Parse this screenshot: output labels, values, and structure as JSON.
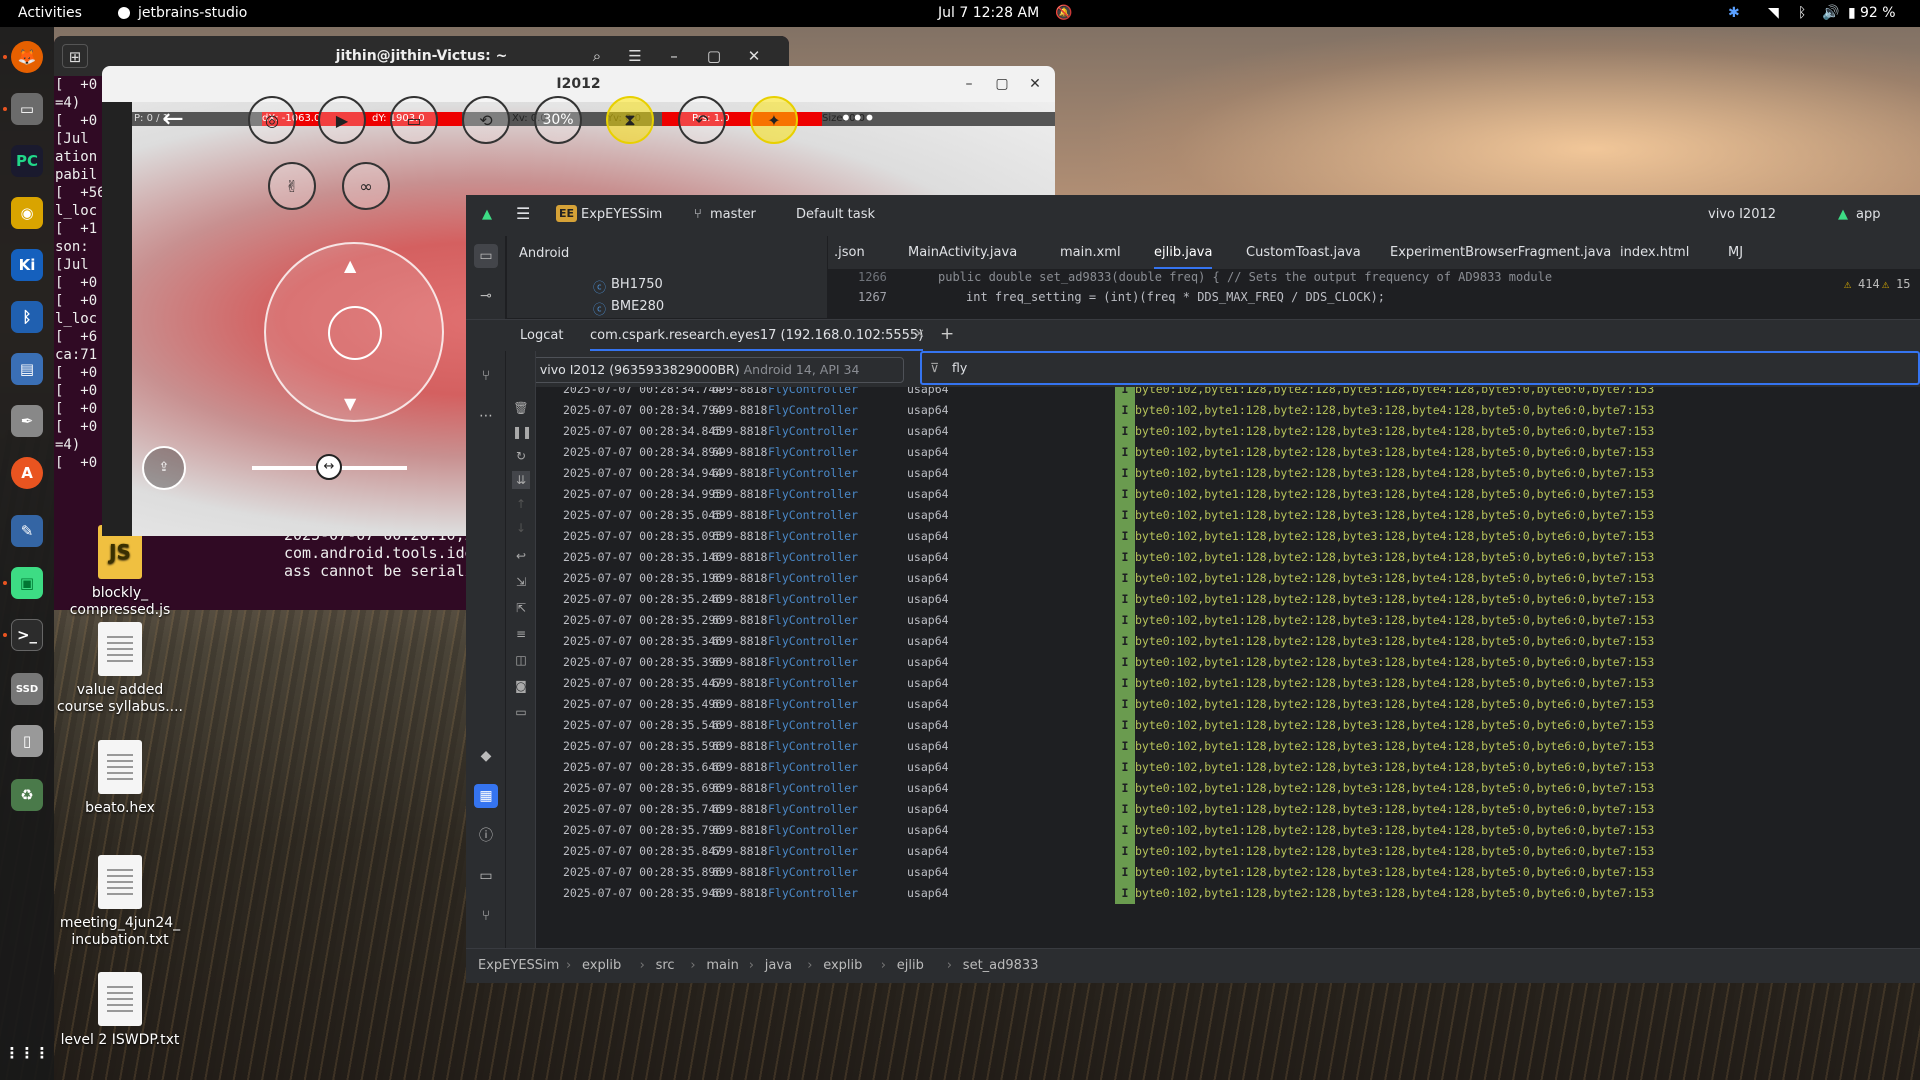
{
  "topbar": {
    "activities": "Activities",
    "app_name": "jetbrains-studio",
    "datetime": "Jul 7  12:28 AM",
    "battery": "92 %"
  },
  "terminal": {
    "title": "jithin@jithin-Victus: ~",
    "lines": [
      "[  +0",
      "=4)",
      "[  +0",
      "[Jul",
      "ation",
      "pabil",
      "[  +56",
      "l_loc",
      "[  +1",
      "son:",
      "[Jul",
      "[  +0",
      "[  +0",
      "l_loc",
      "[  +6",
      "ca:71",
      "[  +0",
      "[  +0",
      "[  +0",
      "[  +0",
      "=4)",
      "[  +0"
    ],
    "bottom_lines": "2025-07-07 00:26:10,265 [4\ncom.android.tools.idea.log\nass cannot be serialized p"
  },
  "mirror": {
    "title": "I2012",
    "tracks": {
      "p": "P: 0 / 1",
      "dx": "dX: -1063.0",
      "dy": "dY: 1903.0",
      "xv": "Xv: 0.0",
      "yv": "Yv: 0.0",
      "prs": "Prs: 1.0",
      "size": "Size: 0.0"
    },
    "percent_button": "30%"
  },
  "desktop_files": [
    {
      "name": "blockly_\ncompressed.js"
    },
    {
      "name": "value added\ncourse syllabus...."
    },
    {
      "name": "beato.hex"
    },
    {
      "name": "meeting_4jun24_\nincubation.txt"
    },
    {
      "name": "level 2 ISWDP.txt"
    }
  ],
  "ide": {
    "project": "ExpEYESSim",
    "project_badge": "EE",
    "branch": "master",
    "task": "Default task",
    "device_run": "vivo I2012",
    "run_config": "app",
    "project_view": "Android",
    "tree_items": [
      "BH1750",
      "BME280"
    ],
    "tabs": [
      ".json",
      "MainActivity.java",
      "main.xml",
      "ejlib.java",
      "CustomToast.java",
      "ExperimentBrowserFragment.java",
      "index.html",
      "MJ"
    ],
    "editor_line_top": "1266",
    "editor_line_mid": "1267",
    "editor_code_top": "public double set_ad9833(double freq) {  // Sets the output frequency of AD9833 module",
    "editor_code_mid": "int freq_setting = (int)(freq * DDS_MAX_FREQ / DDS_CLOCK);",
    "warnings": "414",
    "warnings2": "15",
    "logcat_label": "Logcat",
    "logcat_tab": "com.cspark.research.eyes17 (192.168.0.102:5555)",
    "device_filter": "vivo I2012 (9635933829000BR)",
    "device_api": "Android 14, API 34",
    "filter_text": "fly",
    "breadcrumb": [
      "ExpEYESSim",
      "explib",
      "src",
      "main",
      "java",
      "explib",
      "ejlib",
      "set_ad9833"
    ]
  },
  "log": {
    "pid": "699-8818",
    "tag": "FlyController",
    "process": "usap64",
    "level": "I",
    "message": "byte0:102,byte1:128,byte2:128,byte3:128,byte4:128,byte5:0,byte6:0,byte7:153",
    "timestamps": [
      "2025-07-07 00:28:34.744",
      "2025-07-07 00:28:34.794",
      "2025-07-07 00:28:34.845",
      "2025-07-07 00:28:34.894",
      "2025-07-07 00:28:34.944",
      "2025-07-07 00:28:34.995",
      "2025-07-07 00:28:35.045",
      "2025-07-07 00:28:35.095",
      "2025-07-07 00:28:35.146",
      "2025-07-07 00:28:35.196",
      "2025-07-07 00:28:35.246",
      "2025-07-07 00:28:35.296",
      "2025-07-07 00:28:35.346",
      "2025-07-07 00:28:35.396",
      "2025-07-07 00:28:35.447",
      "2025-07-07 00:28:35.496",
      "2025-07-07 00:28:35.546",
      "2025-07-07 00:28:35.596",
      "2025-07-07 00:28:35.646",
      "2025-07-07 00:28:35.696",
      "2025-07-07 00:28:35.746",
      "2025-07-07 00:28:35.796",
      "2025-07-07 00:28:35.847",
      "2025-07-07 00:28:35.896",
      "2025-07-07 00:28:35.946"
    ]
  },
  "colors": {
    "accent": "#3574f0",
    "tag": "#4a88c7",
    "message": "#b5c25a",
    "info_level": "#6a9b4f"
  }
}
